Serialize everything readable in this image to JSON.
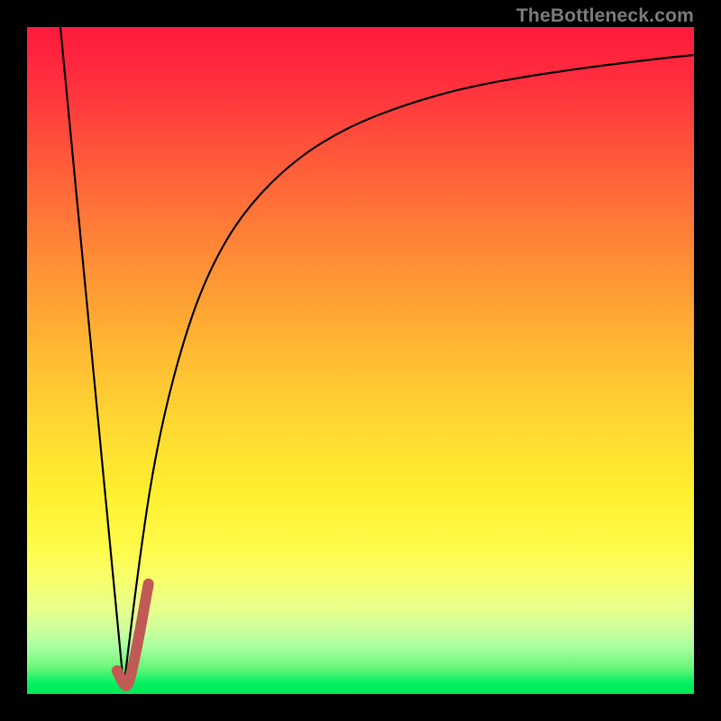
{
  "watermark": "TheBottleneck.com",
  "colors": {
    "page_bg": "#000000",
    "curve_stroke": "#000000",
    "marker_stroke": "#c15a55",
    "gradient_top": "#ff1a3c",
    "gradient_mid": "#fff02f",
    "gradient_bottom": "#00e856"
  },
  "chart_data": {
    "type": "line",
    "title": "",
    "xlabel": "",
    "ylabel": "",
    "xlim": [
      0,
      100
    ],
    "ylim": [
      0,
      100
    ],
    "note": "Two overlaid curves on a red-to-green vertical gradient. Values estimated from pixels; axes are unlabeled (0–100 normalized).",
    "series": [
      {
        "name": "left-line",
        "x": [
          5,
          14.5
        ],
        "values": [
          100,
          1
        ]
      },
      {
        "name": "right-curve",
        "x": [
          14.5,
          17,
          20,
          24,
          28,
          33,
          40,
          48,
          57,
          66,
          76,
          86,
          95,
          100
        ],
        "values": [
          1,
          22,
          40,
          55,
          65,
          73,
          80,
          85,
          88.5,
          91,
          92.8,
          94.2,
          95.3,
          95.8
        ]
      },
      {
        "name": "marker-j",
        "x": [
          13.5,
          14.5,
          15.2,
          16.5,
          18.2
        ],
        "values": [
          3.5,
          1.2,
          1.2,
          7,
          16.5
        ]
      }
    ]
  }
}
